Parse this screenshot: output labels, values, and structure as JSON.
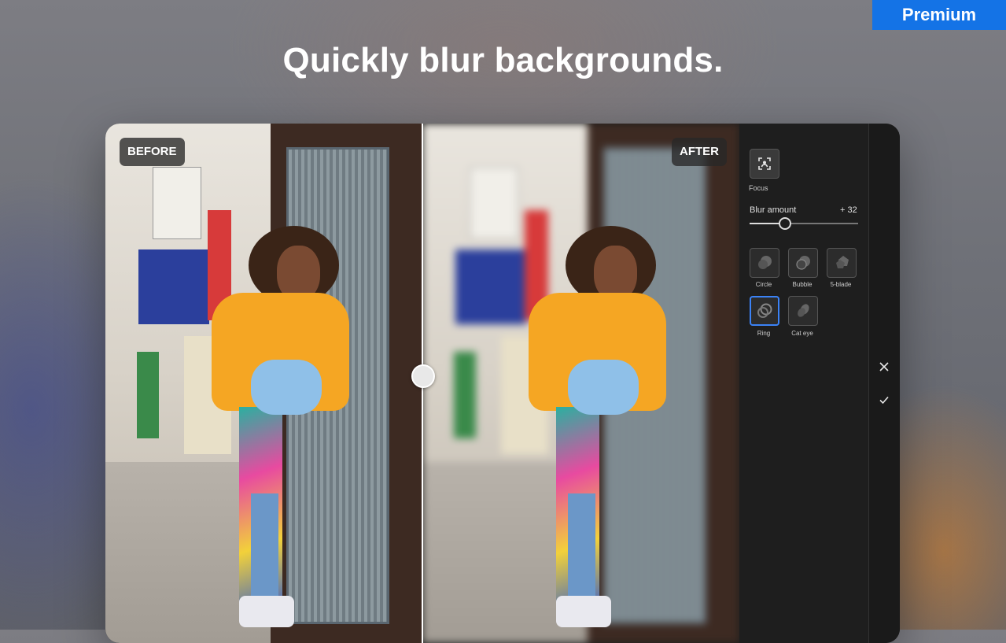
{
  "premium_badge": "Premium",
  "headline": "Quickly blur backgrounds.",
  "compare": {
    "before_label": "BEFORE",
    "after_label": "AFTER"
  },
  "panel": {
    "focus_label": "Focus",
    "blur_amount_label": "Blur amount",
    "blur_amount_value": "+ 32",
    "blur_amount_fraction": 0.32,
    "shapes": [
      {
        "label": "Circle",
        "icon": "circle-bokeh-icon"
      },
      {
        "label": "Bubble",
        "icon": "bubble-bokeh-icon"
      },
      {
        "label": "5-blade",
        "icon": "five-blade-bokeh-icon"
      },
      {
        "label": "Ring",
        "icon": "ring-bokeh-icon",
        "selected": true
      },
      {
        "label": "Cat eye",
        "icon": "cat-eye-bokeh-icon"
      }
    ]
  },
  "actions": {
    "cancel_icon": "close-icon",
    "confirm_icon": "checkmark-icon"
  },
  "colors": {
    "accent": "#1473e6",
    "selected_border": "#3b82f6",
    "panel_bg": "#1e1e1e"
  }
}
